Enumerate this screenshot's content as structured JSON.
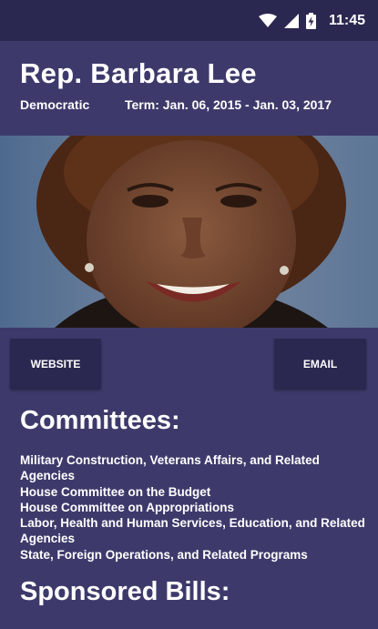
{
  "status_bar": {
    "time": "11:45",
    "icons": [
      "wifi-icon",
      "signal-icon",
      "battery-icon"
    ]
  },
  "header": {
    "name": "Rep. Barbara Lee",
    "party": "Democratic",
    "term": "Term: Jan. 06, 2015 - Jan. 03, 2017"
  },
  "buttons": {
    "website": "WEBSITE",
    "email": "EMAIL"
  },
  "committees": {
    "title": "Committees:",
    "items": [
      "Military Construction, Veterans Affairs, and Related Agencies",
      "House Committee on the Budget",
      "House Committee on Appropriations",
      "Labor, Health and Human Services, Education, and Related Agencies",
      "State, Foreign Operations, and Related Programs"
    ]
  },
  "bills": {
    "title": "Sponsored Bills:"
  },
  "colors": {
    "background": "#3d3a6b",
    "status_bar": "#2a2750",
    "button": "#2a2750",
    "text": "#ffffff"
  }
}
